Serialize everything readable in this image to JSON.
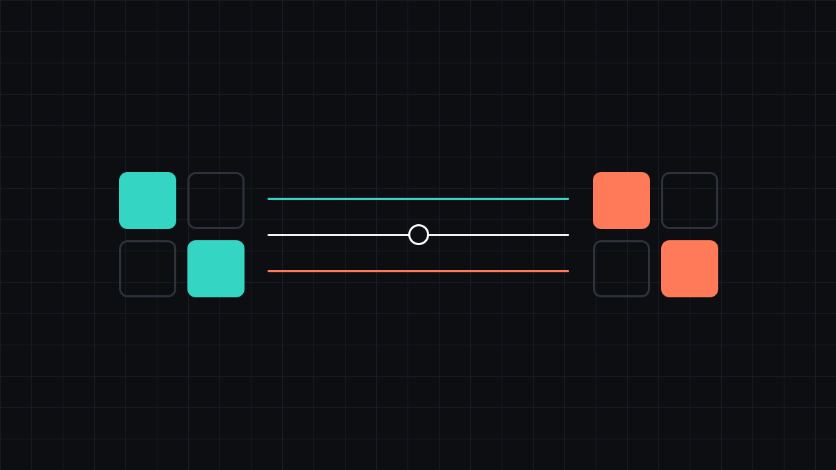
{
  "colors": {
    "background": "#0c0e12",
    "grid_line": "#1a1d23",
    "left_accent": "#34d6c3",
    "right_accent": "#ff7a59",
    "empty_cell_border": "#2d323c",
    "slider_track": "#f2f2f2",
    "slider_thumb_border": "#ffffff"
  },
  "left_grid": {
    "cells": [
      {
        "filled": true
      },
      {
        "filled": false
      },
      {
        "filled": false
      },
      {
        "filled": true
      }
    ]
  },
  "right_grid": {
    "cells": [
      {
        "filled": true
      },
      {
        "filled": false
      },
      {
        "filled": false
      },
      {
        "filled": true
      }
    ]
  },
  "slider": {
    "value": 0.5
  },
  "icons": {
    "thumb": "circle-handle-icon"
  }
}
